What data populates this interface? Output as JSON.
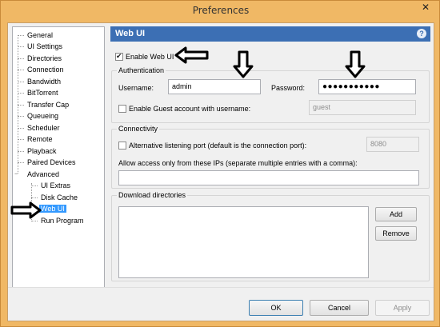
{
  "window": {
    "title": "Preferences",
    "close_symbol": "✕"
  },
  "tree": {
    "items": [
      {
        "label": "General",
        "selected": false
      },
      {
        "label": "UI Settings",
        "selected": false
      },
      {
        "label": "Directories",
        "selected": false
      },
      {
        "label": "Connection",
        "selected": false
      },
      {
        "label": "Bandwidth",
        "selected": false
      },
      {
        "label": "BitTorrent",
        "selected": false
      },
      {
        "label": "Transfer Cap",
        "selected": false
      },
      {
        "label": "Queueing",
        "selected": false
      },
      {
        "label": "Scheduler",
        "selected": false
      },
      {
        "label": "Remote",
        "selected": false
      },
      {
        "label": "Playback",
        "selected": false
      },
      {
        "label": "Paired Devices",
        "selected": false
      },
      {
        "label": "Advanced",
        "selected": false,
        "expander": "−"
      },
      {
        "label": "UI Extras",
        "selected": false
      },
      {
        "label": "Disk Cache",
        "selected": false
      },
      {
        "label": "Web UI",
        "selected": true
      },
      {
        "label": "Run Program",
        "selected": false
      }
    ]
  },
  "panel": {
    "header": "Web UI",
    "help_symbol": "?",
    "enable_web_ui": {
      "label": "Enable Web UI",
      "checked": true
    },
    "authentication": {
      "title": "Authentication",
      "username_label": "Username:",
      "username_value": "admin",
      "password_label": "Password:",
      "password_value": "●●●●●●●●●●●",
      "guest_label": "Enable Guest account with username:",
      "guest_checked": false,
      "guest_value": "guest"
    },
    "connectivity": {
      "title": "Connectivity",
      "alt_port_label": "Alternative listening port (default is the connection port):",
      "alt_port_checked": false,
      "alt_port_value": "8080",
      "allow_ips_label": "Allow access only from these IPs (separate multiple entries with a comma):",
      "allow_ips_value": ""
    },
    "download_dirs": {
      "title": "Download directories",
      "add_label": "Add",
      "remove_label": "Remove"
    }
  },
  "footer": {
    "ok": "OK",
    "cancel": "Cancel",
    "apply": "Apply"
  },
  "colors": {
    "header": "#3c6fb4",
    "selection": "#3399ff",
    "frame": "#f0b865"
  }
}
